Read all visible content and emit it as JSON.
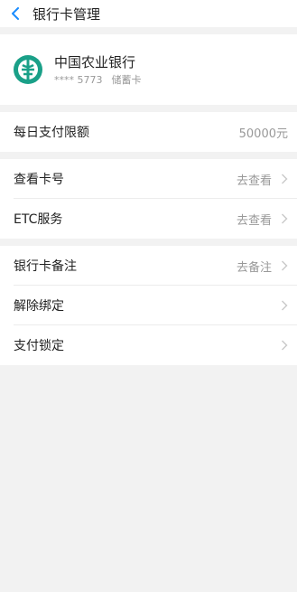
{
  "header": {
    "title": "银行卡管理"
  },
  "bank": {
    "name": "中国农业银行",
    "number": "**** 5773",
    "type": "储蓄卡"
  },
  "limit": {
    "label": "每日支付限额",
    "value": "50000元"
  },
  "group2": [
    {
      "label": "查看卡号",
      "action": "去查看"
    },
    {
      "label": "ETC服务",
      "action": "去查看"
    }
  ],
  "group3": [
    {
      "label": "银行卡备注",
      "action": "去备注"
    },
    {
      "label": "解除绑定",
      "action": ""
    },
    {
      "label": "支付锁定",
      "action": ""
    }
  ],
  "colors": {
    "accent": "#1a8cff",
    "brand": "#1aa088"
  }
}
